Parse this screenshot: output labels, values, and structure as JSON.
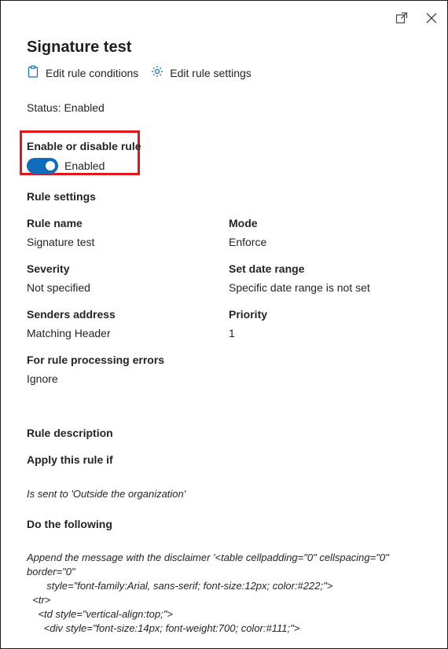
{
  "panel": {
    "title": "Signature test",
    "actions": {
      "edit_conditions": "Edit rule conditions",
      "edit_settings": "Edit rule settings"
    },
    "status": "Status: Enabled",
    "toggle": {
      "title": "Enable or disable rule",
      "state_label": "Enabled",
      "on": true,
      "accent": "#0f6cbd"
    },
    "highlight_color": "#e3161b"
  },
  "rule_settings": {
    "title": "Rule settings",
    "rule_name_label": "Rule name",
    "rule_name_value": "Signature test",
    "mode_label": "Mode",
    "mode_value": "Enforce",
    "severity_label": "Severity",
    "severity_value": "Not specified",
    "date_label": "Set date range",
    "date_value": "Specific date range is not set",
    "senders_label": "Senders address",
    "senders_value": "Matching Header",
    "priority_label": "Priority",
    "priority_value": "1",
    "errors_label": "For rule processing errors",
    "errors_value": "Ignore"
  },
  "rule_description": {
    "title": "Rule description",
    "apply_title": "Apply this rule if",
    "apply_text": "Is sent to 'Outside the organization'",
    "do_title": "Do the following",
    "do_text": "Append the message with the disclaimer '<table cellpadding=\"0\" cellspacing=\"0\" border=\"0\"\n       style=\"font-family:Arial, sans-serif; font-size:12px; color:#222;\">\n  <tr>\n    <td style=\"vertical-align:top;\">\n      <div style=\"font-size:14px; font-weight:700; color:#111;\">"
  },
  "icons": {
    "popout": "popout-icon",
    "close": "close-icon",
    "clipboard": "clipboard-icon",
    "gear": "gear-icon"
  }
}
